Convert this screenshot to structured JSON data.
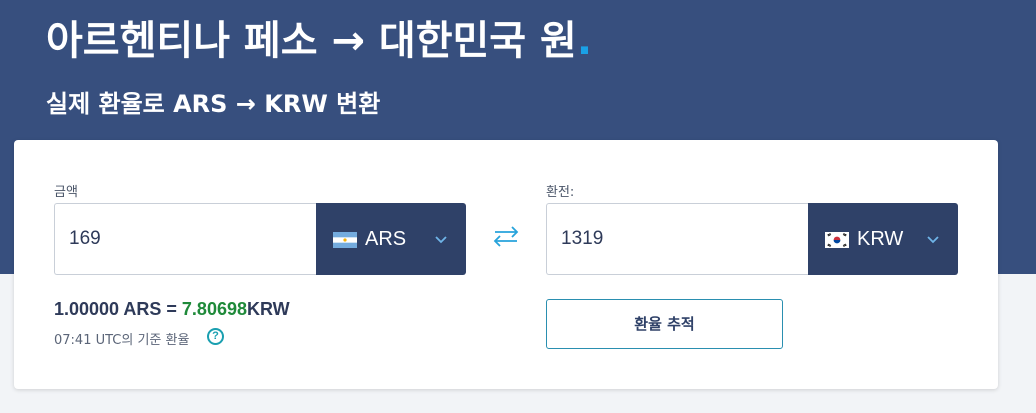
{
  "hero": {
    "title": "아르헨티나 페소 → 대한민국 원",
    "title_dot": ".",
    "subtitle": "실제 환율로 ARS → KRW 변환"
  },
  "converter": {
    "amount_label": "금액",
    "amount_value": "169",
    "from_currency": {
      "code": "ARS",
      "flag": "argentina-flag"
    },
    "converted_label": "환전:",
    "converted_value": "1319",
    "to_currency": {
      "code": "KRW",
      "flag": "korea-flag"
    },
    "rate": {
      "prefix": "1.00000 ARS = ",
      "value": "7.80698",
      "suffix": "KRW"
    },
    "rate_note": "07:41 UTC의 기준 환율",
    "help_glyph": "?",
    "track_button": "환율 추적"
  },
  "colors": {
    "hero_bg": "#374f7e",
    "select_bg": "#2f4168",
    "rate_value": "#1f8a3a",
    "accent": "#1aa1e6"
  }
}
